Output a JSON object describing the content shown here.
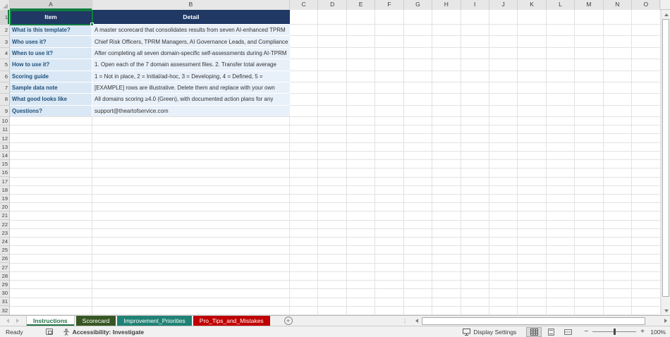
{
  "colors": {
    "table_header_fill": "#1F3864",
    "table_header_text": "#FFFFFF",
    "item_cell_fill": "#DAE8F5",
    "detail_cell_fill": "#E8F0F9",
    "item_text": "#1F4E79",
    "detail_text": "#333333",
    "selection_green": "#107C41",
    "active_tab_text": "#217346"
  },
  "grid": {
    "column_letters": [
      "A",
      "B",
      "C",
      "D",
      "E",
      "F",
      "G",
      "H",
      "I",
      "J",
      "K",
      "L",
      "M",
      "N",
      "O"
    ],
    "visible_rows": 32,
    "selected_cell": "A1"
  },
  "table": {
    "header": {
      "item": "Item",
      "detail": "Detail"
    },
    "rows": [
      {
        "item": "What is this template?",
        "detail": "A master scorecard that consolidates results from seven AI-enhanced TPRM"
      },
      {
        "item": "Who uses it?",
        "detail": "Chief Risk Officers, TPRM Managers, AI Governance Leads, and Compliance"
      },
      {
        "item": "When to use it?",
        "detail": "After completing all seven domain-specific self-assessments during AI-TPRM"
      },
      {
        "item": "How to use it?",
        "detail": "1. Open each of the 7 domain assessment files. 2. Transfer total average"
      },
      {
        "item": "Scoring guide",
        "detail": "1 = Not in place, 2 = Initial/ad-hoc, 3 = Developing, 4 = Defined, 5 ="
      },
      {
        "item": "Sample data note",
        "detail": "[EXAMPLE] rows are illustrative. Delete them and replace with your own"
      },
      {
        "item": "What good looks like",
        "detail": "All domains scoring ≥4.0 (Green), with documented action plans for any"
      },
      {
        "item": "Questions?",
        "detail": "support@theartofservice.com"
      }
    ]
  },
  "sheet_tabs": [
    {
      "label": "Instructions",
      "active": true,
      "color": "#FFFFFF"
    },
    {
      "label": "Scorecard",
      "active": false,
      "color": "#375623"
    },
    {
      "label": "Improvement_Priorities",
      "active": false,
      "color": "#1F8274"
    },
    {
      "label": "Pro_Tips_and_Mistakes",
      "active": false,
      "color": "#C00000"
    }
  ],
  "icons": {
    "add_sheet": "+",
    "tab_splitter": "⋮",
    "zoom_out": "−",
    "zoom_in": "+"
  },
  "status_bar": {
    "ready_label": "Ready",
    "accessibility_label": "Accessibility: Investigate",
    "display_settings_label": "Display Settings",
    "zoom_percentage": "100%"
  }
}
